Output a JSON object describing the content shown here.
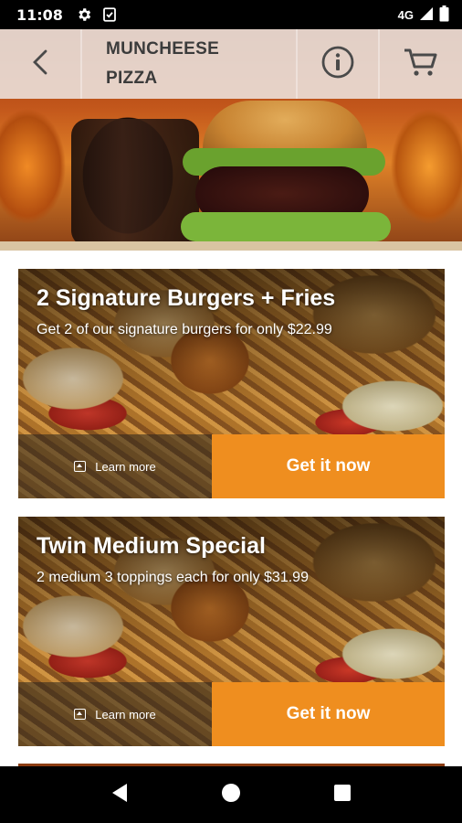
{
  "status_bar": {
    "time": "11:08",
    "network": "4G",
    "icons": [
      "settings-icon",
      "clipboard-icon",
      "signal-icon",
      "battery-icon"
    ]
  },
  "header": {
    "title": "MUNCHEESE\nPIZZA",
    "icons": [
      "back-arrow-icon",
      "info-icon",
      "cart-icon"
    ]
  },
  "offers": [
    {
      "title": "2 Signature Burgers + Fries",
      "description": "Get 2 of our signature burgers for only $22.99",
      "learn_more_label": "Learn more",
      "cta_label": "Get it now"
    },
    {
      "title": "Twin Medium Special",
      "description": "2 medium 3 toppings each for only $31.99",
      "learn_more_label": "Learn more",
      "cta_label": "Get it now"
    }
  ],
  "colors": {
    "accent": "#EF8E1F",
    "toolbar_tile": "#EEE8E4",
    "title_text": "#3B3B3B"
  },
  "nav_bar": {
    "icons": [
      "back-triangle-icon",
      "home-circle-icon",
      "recents-square-icon"
    ]
  }
}
